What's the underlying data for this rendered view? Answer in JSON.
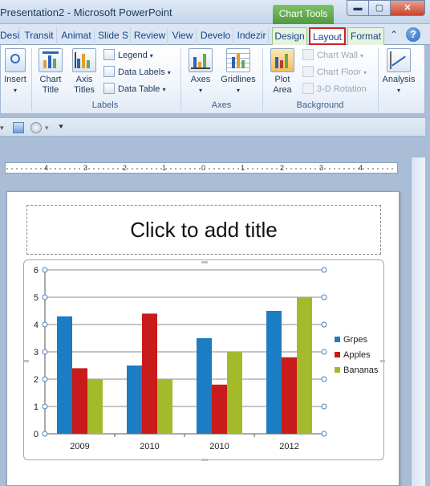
{
  "window": {
    "title": "Presentation2  -  Microsoft PowerPoint",
    "context_tab": "Chart Tools",
    "controls": {
      "minimize": "▬",
      "maximize": "▢",
      "close": "✕"
    }
  },
  "tabs": [
    {
      "label": "Desigr"
    },
    {
      "label": "Transit"
    },
    {
      "label": "Animat"
    },
    {
      "label": "Slide S"
    },
    {
      "label": "Review"
    },
    {
      "label": "View"
    },
    {
      "label": "Develo"
    },
    {
      "label": "Indezir"
    },
    {
      "label": "Design"
    },
    {
      "label": "Layout"
    },
    {
      "label": "Format"
    }
  ],
  "ribbon": {
    "insert": {
      "label": "Insert"
    },
    "labels_group": {
      "name": "Labels",
      "chart_title": "Chart\nTitle",
      "axis_titles": "Axis\nTitles",
      "legend": "Legend",
      "data_labels": "Data Labels",
      "data_table": "Data Table"
    },
    "axes_group": {
      "name": "Axes",
      "axes": "Axes",
      "gridlines": "Gridlines"
    },
    "background_group": {
      "name": "Background",
      "plot_area": "Plot\nArea",
      "chart_wall": "Chart Wall",
      "chart_floor": "Chart Floor",
      "rotation": "3-D Rotation"
    },
    "analysis": {
      "label": "Analysis"
    }
  },
  "ruler": {
    "ticks": [
      "4",
      "3",
      "2",
      "1",
      "0",
      "1",
      "2",
      "3",
      "4"
    ]
  },
  "slide": {
    "title_placeholder": "Click to add title"
  },
  "chart_data": {
    "type": "bar",
    "categories": [
      "2009",
      "2010",
      "2010",
      "2012"
    ],
    "series": [
      {
        "name": "Grpes",
        "color": "#1b7dc4",
        "values": [
          4.3,
          2.5,
          3.5,
          4.5
        ]
      },
      {
        "name": "Apples",
        "color": "#c81b1b",
        "values": [
          2.4,
          4.4,
          1.8,
          2.8
        ]
      },
      {
        "name": "Bananas",
        "color": "#a3bb2a",
        "values": [
          2.0,
          2.0,
          3.0,
          5.0
        ]
      }
    ],
    "ylim": [
      0,
      6
    ],
    "yticks": [
      "0",
      "1",
      "2",
      "3",
      "4",
      "5",
      "6"
    ],
    "grid": true,
    "legend": "right"
  }
}
